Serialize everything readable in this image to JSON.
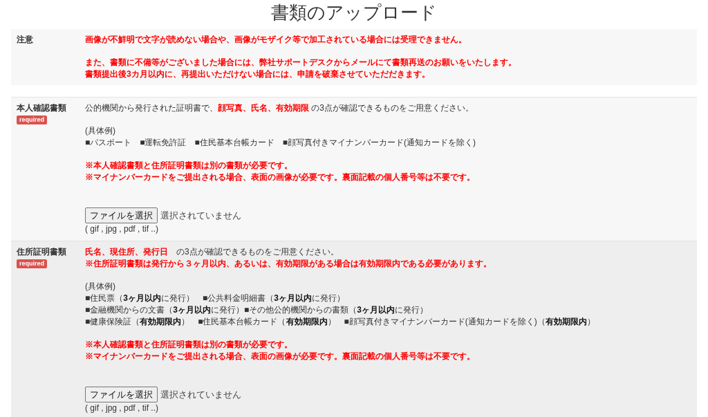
{
  "title": "書類のアップロード",
  "sections": [
    {
      "label": "注意",
      "paragraphs": [
        [
          {
            "kind": "warning",
            "text": "画像が不鮮明で文字が読めない場合や、画像がモザイク等で加工されている場合には受理できません。"
          }
        ],
        [
          {
            "kind": "warning",
            "text": "また、書類に不備等がございました場合には、弊社サポートデスクからメールにて書類再送のお願いをいたします。"
          },
          {
            "kind": "warning",
            "text": "書類提出後3カ月以内に、再提出いただけない場合には、申請を破棄させていただだきます。"
          }
        ]
      ]
    },
    {
      "label": "本人確認書類",
      "badge": "required",
      "paragraphs": [
        [
          {
            "kind": "intro",
            "text": "公的機関から発行された証明書で、**顔写真、氏名、有効期限** の3点が確認できるものをご用意ください。"
          }
        ],
        [
          {
            "kind": "plain",
            "text": "(具体例)"
          },
          {
            "kind": "plain",
            "text": "■パスポート　■運転免許証　■住民基本台帳カード　■顔写真付きマイナンバーカード(通知カードを除く)"
          }
        ],
        [
          {
            "kind": "warning",
            "text": "※本人確認書類と住所証明書類は別の書類が必要です。"
          },
          {
            "kind": "warning",
            "text": "※マイナンバーカードをご提出される場合、表面の画像が必要です。裏面記載の個人番号等は不要です。"
          }
        ]
      ],
      "file": {
        "button": "ファイルを選択",
        "status": "選択されていません",
        "hint": "( gif , jpg , pdf , tif ..)"
      }
    },
    {
      "label": "住所証明書類",
      "badge": "required",
      "paragraphs": [
        [
          {
            "kind": "intro",
            "text": "**氏名、現住所、発行日**　の3点が確認できるものをご用意ください。"
          },
          {
            "kind": "warning",
            "text": "※住所証明書類は発行から３ヶ月以内、あるいは、有効期限がある場合は有効期限内である必要があります。"
          }
        ],
        [
          {
            "kind": "plain",
            "text": "(具体例)"
          },
          {
            "kind": "plain",
            "text": "■住民票（**3ヶ月以内**に発行）　■公共料金明細書（**3ヶ月以内**に発行）"
          },
          {
            "kind": "plain",
            "text": "■金融機関からの文書（**3ヶ月以内**に発行）■その他公的機関からの書類（**3ヶ月以内**に発行）"
          },
          {
            "kind": "plain",
            "text": "■健康保険証（**有効期限内**）　■住民基本台帳カード（**有効期限内**）　■顔写真付きマイナンバーカード(通知カードを除く)（**有効期限内**）"
          }
        ],
        [
          {
            "kind": "warning",
            "text": "※本人確認書類と住所証明書類は別の書類が必要です。"
          },
          {
            "kind": "warning",
            "text": "※マイナンバーカードをご提出される場合、表面の画像が必要です。裏面記載の個人番号等は不要です。"
          }
        ]
      ],
      "file": {
        "button": "ファイルを選択",
        "status": "選択されていません",
        "hint": "( gif , jpg , pdf , tif ..)"
      }
    }
  ]
}
